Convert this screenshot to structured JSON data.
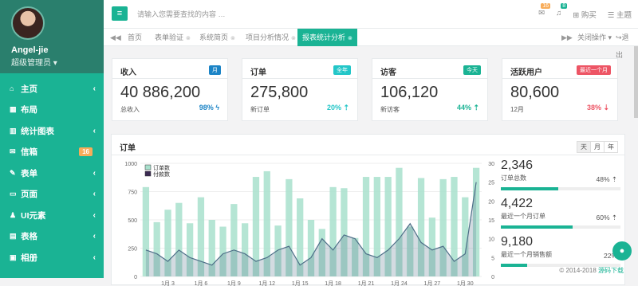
{
  "profile": {
    "name": "Angel-jie",
    "role": "超级管理员 ▾"
  },
  "nav": [
    {
      "icon": "⌂",
      "label": "主页",
      "chev": "‹"
    },
    {
      "icon": "▦",
      "label": "布局",
      "chev": ""
    },
    {
      "icon": "▥",
      "label": "统计图表",
      "chev": "‹"
    },
    {
      "icon": "✉",
      "label": "信箱",
      "badge": "16"
    },
    {
      "icon": "✎",
      "label": "表单",
      "chev": "‹"
    },
    {
      "icon": "▭",
      "label": "页面",
      "chev": "‹"
    },
    {
      "icon": "♟",
      "label": "UI元素",
      "chev": "‹"
    },
    {
      "icon": "▤",
      "label": "表格",
      "chev": "‹"
    },
    {
      "icon": "▣",
      "label": "相册",
      "chev": "‹"
    }
  ],
  "topbar": {
    "menu": "≡",
    "search_placeholder": "请输入您需要查找的内容 …",
    "mail_count": "16",
    "bell_count": "8",
    "buy": "购买",
    "theme": "主题"
  },
  "tabs": [
    "首页",
    "表单验证",
    "系统简页",
    "项目分析情况",
    "报表统计分析"
  ],
  "tab_controls": {
    "close_ops": "关闭操作 ▾",
    "exit": "退出"
  },
  "stats": [
    {
      "title": "收入",
      "badge": "月",
      "badge_color": "#1c84c6",
      "value": "40 886,200",
      "sub": "总收入",
      "pct": "98% ϟ",
      "pct_color": "#1c84c6"
    },
    {
      "title": "订单",
      "badge": "全年",
      "badge_color": "#23c6c8",
      "value": "275,800",
      "sub": "新订单",
      "pct": "20% ⇡",
      "pct_color": "#23c6c8"
    },
    {
      "title": "访客",
      "badge": "今天",
      "badge_color": "#1ab394",
      "value": "106,120",
      "sub": "新访客",
      "pct": "44% ⇡",
      "pct_color": "#1ab394"
    },
    {
      "title": "活跃用户",
      "badge": "最近一个月",
      "badge_color": "#ed5565",
      "value": "80,600",
      "sub": "12月",
      "pct": "38% ⇣",
      "pct_color": "#ed5565"
    }
  ],
  "panel": {
    "title": "订单",
    "periods": [
      "天",
      "月",
      "年"
    ]
  },
  "side_stats": [
    {
      "value": "2,346",
      "label": "订单总数",
      "pct": "48% ⇡",
      "fill": 0.48
    },
    {
      "value": "4,422",
      "label": "最近一个月订单",
      "pct": "60% ⇡",
      "fill": 0.6
    },
    {
      "value": "9,180",
      "label": "最近一个月销售额",
      "pct": "22%",
      "fill": 0.22
    }
  ],
  "footer": {
    "copy": "© 2014-2018 ",
    "link": "源码下载"
  },
  "chart_data": {
    "type": "bar",
    "legend": [
      "订单数",
      "付款数"
    ],
    "colors": {
      "bars": "#a8e0cc",
      "line": "#4e6f88"
    },
    "yleft": [
      0,
      250,
      500,
      750,
      1000
    ],
    "yright": [
      0,
      5,
      10,
      15,
      20,
      25,
      30
    ],
    "xticks": [
      "1月 3",
      "1月 6",
      "1月 9",
      "1月 12",
      "1月 15",
      "1月 18",
      "1月 21",
      "1月 24",
      "1月 27",
      "1月 30"
    ],
    "bars": [
      790,
      480,
      590,
      650,
      470,
      700,
      500,
      440,
      640,
      470,
      880,
      930,
      450,
      860,
      690,
      500,
      420,
      790,
      780,
      340,
      880,
      880,
      880,
      960,
      440,
      870,
      520,
      860,
      880,
      700,
      960
    ],
    "line": [
      7,
      6,
      4,
      7,
      5,
      4,
      3,
      6,
      7,
      6,
      4,
      5,
      7,
      8,
      3,
      5,
      10,
      7,
      11,
      10,
      6,
      5,
      7,
      10,
      14,
      9,
      7,
      8,
      4,
      6,
      25
    ]
  }
}
